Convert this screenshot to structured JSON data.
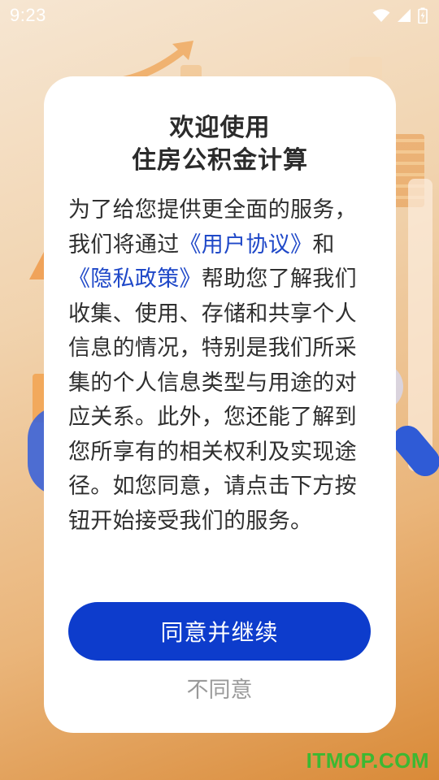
{
  "status_bar": {
    "time": "9:23",
    "icons": [
      "wifi-icon",
      "cellular-signal-icon",
      "battery-charging-icon"
    ]
  },
  "dialog": {
    "title_line1": "欢迎使用",
    "title_line2": "住房公积金计算",
    "body": {
      "text_1": "为了给您提供更全面的服务，我们将通过",
      "link_user_agreement": "《用户协议》",
      "text_2": "和",
      "link_privacy_policy": "《隐私政策》",
      "text_3": "帮助您了解我们收集、使用、存储和共享个人信息的情况，特别是我们所采集的个人信息类型与用途的对应关系。此外，您还能了解到您所享有的相关权利及实现途径。如您同意，请点击下方按钮开始接受我们的服务。"
    },
    "agree_label": "同意并继续",
    "disagree_label": "不同意"
  },
  "watermark": "ITMOP.COM",
  "colors": {
    "primary_button": "#0d3ccc",
    "link": "#1f48c8",
    "watermark": "#3cb832"
  }
}
